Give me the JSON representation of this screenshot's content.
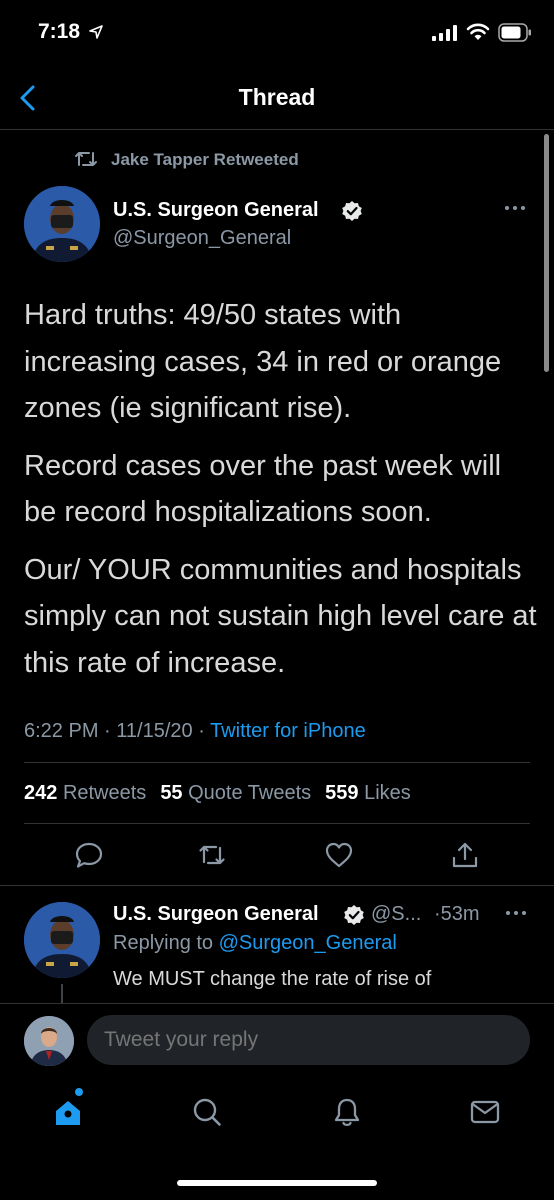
{
  "status_bar": {
    "time": "7:18"
  },
  "nav": {
    "title": "Thread"
  },
  "retweet": {
    "label": "Jake Tapper Retweeted"
  },
  "tweet": {
    "author_name": "U.S. Surgeon General",
    "author_handle": "@Surgeon_General",
    "paragraphs": [
      "Hard truths: 49/50 states with increasing cases, 34 in red or orange zones (ie significant rise).",
      "Record cases over the past week will be record hospitalizations soon.",
      "Our/ YOUR communities and hospitals simply can not sustain high level care at this rate of increase."
    ],
    "time": "6:22 PM",
    "date": "11/15/20",
    "source": "Twitter for iPhone",
    "retweets_count": "242",
    "retweets_label": "Retweets",
    "quotes_count": "55",
    "quotes_label": "Quote Tweets",
    "likes_count": "559",
    "likes_label": "Likes"
  },
  "reply": {
    "author_name": "U.S. Surgeon General",
    "author_handle": "@S...",
    "time": "53m",
    "replying_label": "Replying to",
    "replying_to": "@Surgeon_General",
    "text": "We MUST change the rate of rise of"
  },
  "composer": {
    "placeholder": "Tweet your reply"
  },
  "tabs": [
    {
      "icon": "home-icon"
    },
    {
      "icon": "search-icon"
    },
    {
      "icon": "notifications-icon"
    },
    {
      "icon": "messages-icon"
    }
  ],
  "colors": {
    "accent": "#1d9bf0",
    "muted": "#8b98a5",
    "background": "#000000"
  }
}
